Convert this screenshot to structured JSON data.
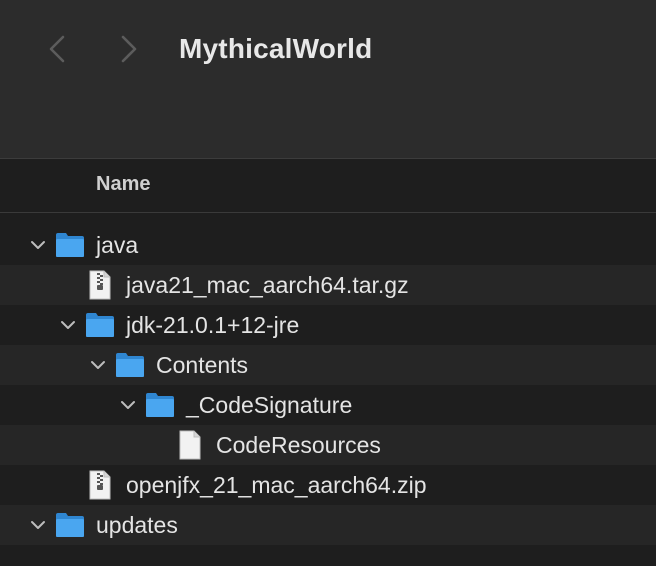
{
  "window": {
    "title": "MythicalWorld"
  },
  "header": {
    "name_column": "Name"
  },
  "rows": [
    {
      "label": "java",
      "type": "folder",
      "expanded": true
    },
    {
      "label": "java21_mac_aarch64.tar.gz",
      "type": "archive"
    },
    {
      "label": "jdk-21.0.1+12-jre",
      "type": "folder",
      "expanded": true
    },
    {
      "label": "Contents",
      "type": "folder",
      "expanded": true
    },
    {
      "label": "_CodeSignature",
      "type": "folder",
      "expanded": true
    },
    {
      "label": "CodeResources",
      "type": "file"
    },
    {
      "label": "openjfx_21_mac_aarch64.zip",
      "type": "archive"
    },
    {
      "label": "updates",
      "type": "folder",
      "expanded": true
    }
  ],
  "colors": {
    "folder": "#4aa6f0",
    "folder_dark": "#2f86d1",
    "toolbar_bg": "#2c2c2c",
    "window_bg": "#1e1e1e",
    "alt_row": "#262626"
  }
}
